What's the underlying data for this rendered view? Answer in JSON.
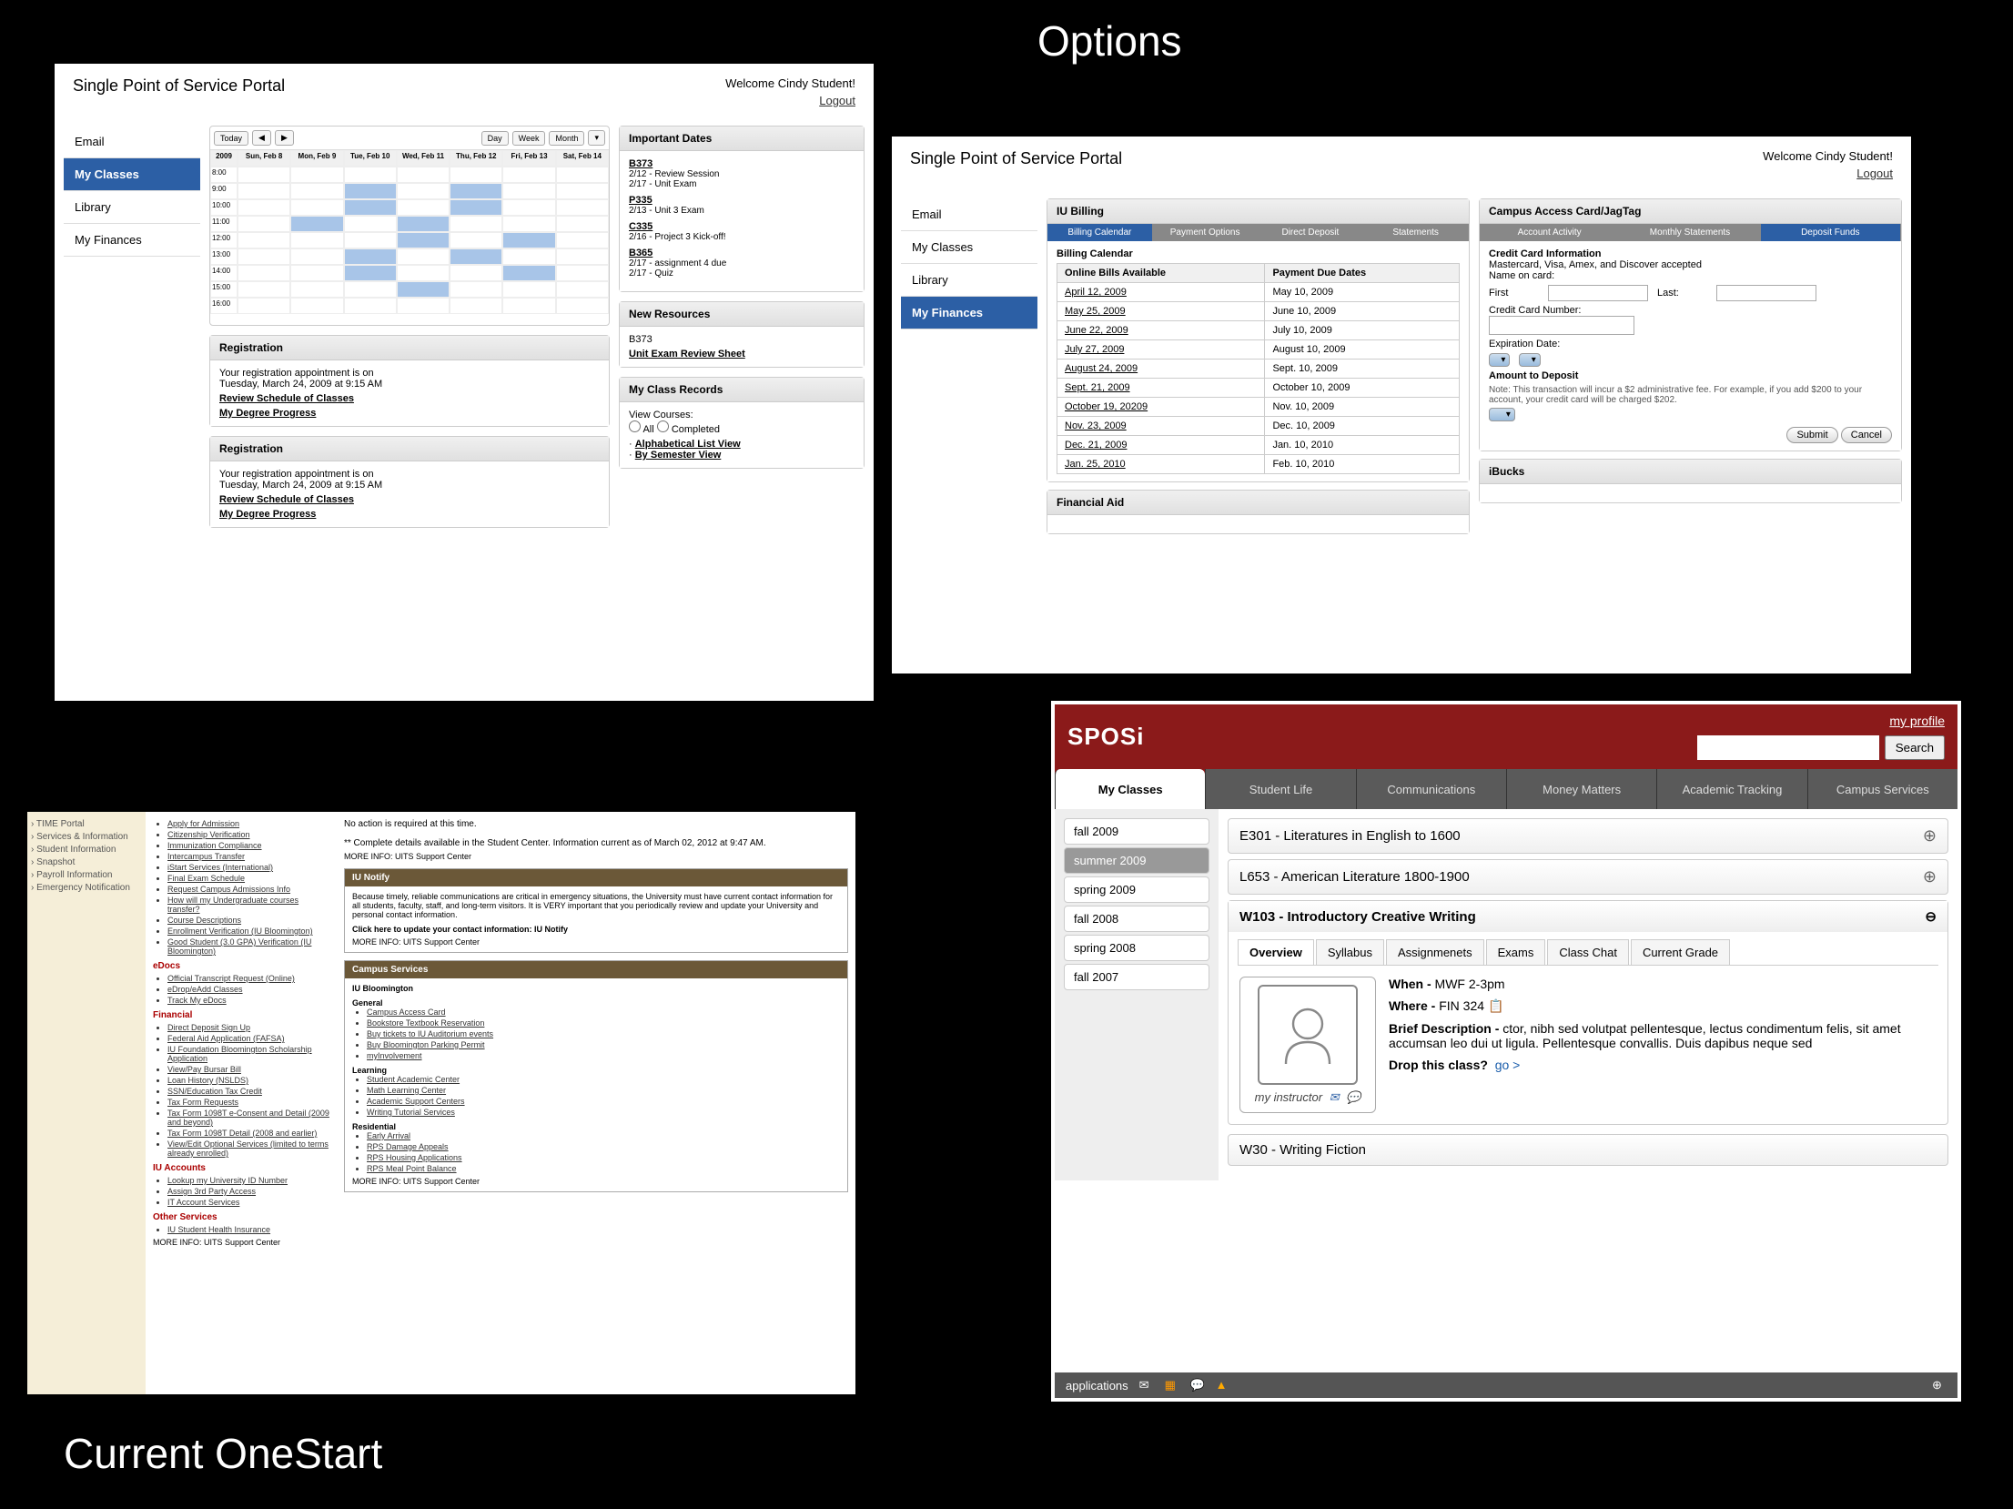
{
  "slideTitles": {
    "options": "Options",
    "current": "Current OneStart"
  },
  "portal": {
    "title": "Single Point of Service Portal",
    "welcome": "Welcome Cindy Student!",
    "logout": "Logout",
    "nav": [
      "Email",
      "My Classes",
      "Library",
      "My Finances"
    ]
  },
  "panel1": {
    "activeNav": "My Classes",
    "calendar": {
      "today": "Today",
      "views": [
        "Day",
        "Week",
        "Month"
      ],
      "days": [
        "Sun, Feb 8",
        "Mon, Feb 9",
        "Tue, Feb 10",
        "Wed, Feb 11",
        "Thu, Feb 12",
        "Fri, Feb 13",
        "Sat, Feb 14"
      ],
      "yearLabel": "2009"
    },
    "importantDates": {
      "title": "Important Dates",
      "items": [
        {
          "course": "B373",
          "lines": [
            "2/12 - Review Session",
            "2/17 - Unit Exam"
          ]
        },
        {
          "course": "P335",
          "lines": [
            "2/13 - Unit 3 Exam"
          ]
        },
        {
          "course": "C335",
          "lines": [
            "2/16 - Project 3 Kick-off!"
          ]
        },
        {
          "course": "B365",
          "lines": [
            "2/17 - assignment 4 due",
            "2/17 - Quiz"
          ]
        }
      ]
    },
    "registration": {
      "title": "Registration",
      "line1": "Your registration appointment is on",
      "line2": "Tuesday, March 24, 2009 at 9:15 AM",
      "links": [
        "Review Schedule of Classes",
        "My Degree Progress"
      ]
    },
    "newResources": {
      "title": "New Resources",
      "course": "B373",
      "link": "Unit Exam Review Sheet"
    },
    "classRecords": {
      "title": "My Class Records",
      "viewLabel": "View Courses:",
      "radio1": "All",
      "radio2": "Completed",
      "links": [
        "Alphabetical List View",
        "By Semester View"
      ]
    }
  },
  "panel2": {
    "activeNav": "My Finances",
    "billing": {
      "title": "IU Billing",
      "tabs": [
        "Billing Calendar",
        "Payment Options",
        "Direct Deposit",
        "Statements"
      ],
      "activeTab": "Billing Calendar",
      "calTitle": "Billing Calendar",
      "col1": "Online Bills Available",
      "col2": "Payment Due Dates",
      "rows": [
        [
          "April 12, 2009",
          "May 10, 2009"
        ],
        [
          "May 25, 2009",
          "June 10, 2009"
        ],
        [
          "June 22, 2009",
          "July 10, 2009"
        ],
        [
          "July 27, 2009",
          "August 10, 2009"
        ],
        [
          "August 24, 2009",
          "Sept. 10, 2009"
        ],
        [
          "Sept. 21, 2009",
          "October 10, 2009"
        ],
        [
          "October 19, 20209",
          "Nov. 10, 2009"
        ],
        [
          "Nov. 23, 2009",
          "Dec. 10, 2009"
        ],
        [
          "Dec. 21, 2009",
          "Jan. 10, 2010"
        ],
        [
          "Jan. 25, 2010",
          "Feb. 10, 2010"
        ]
      ]
    },
    "card": {
      "title": "Campus Access Card/JagTag",
      "tabs": [
        "Account Activity",
        "Monthly Statements",
        "Deposit Funds"
      ],
      "activeTab": "Deposit Funds",
      "ccTitle": "Credit Card Information",
      "ccAccepted": "Mastercard, Visa, Amex, and Discover accepted",
      "nameLabel": "Name on card:",
      "first": "First",
      "last": "Last:",
      "ccNum": "Credit Card Number:",
      "expDate": "Expiration Date:",
      "amount": "Amount to Deposit",
      "note": "Note: This transaction will incur a $2 administrative fee.  For example, if you add $200 to your account, your credit card will be charged $202.",
      "submit": "Submit",
      "cancel": "Cancel"
    },
    "finAid": {
      "title": "Financial Aid"
    },
    "ibucks": {
      "title": "iBucks"
    }
  },
  "panel3": {
    "leftNav": [
      "TIME Portal",
      "Services & Information",
      "Student Information",
      "Snapshot",
      "Payroll Information",
      "Emergency Notification"
    ],
    "mid": {
      "sections": [
        {
          "links": [
            "Apply for Admission",
            "Citizenship Verification",
            "Immunization Compliance",
            "Intercampus Transfer",
            "iStart Services (International)",
            "Final Exam Schedule",
            "Request Campus Admissions Info",
            "How will my Undergraduate courses transfer?",
            "Course Descriptions",
            "Enrollment Verification (IU Bloomington)",
            "Good Student (3.0 GPA) Verification (IU Bloomington)"
          ]
        },
        {
          "head": "eDocs",
          "links": [
            "Official Transcript Request (Online)",
            "eDrop/eAdd Classes",
            "Track My eDocs"
          ]
        },
        {
          "head": "Financial",
          "links": [
            "Direct Deposit Sign Up",
            "Federal Aid Application (FAFSA)",
            "IU Foundation Bloomington Scholarship Application",
            "View/Pay Bursar Bill",
            "Loan History (NSLDS)",
            "SSN/Education Tax Credit",
            "Tax Form Requests",
            "Tax Form 1098T e-Consent and Detail (2009 and beyond)",
            "Tax Form 1098T Detail (2008 and earlier)",
            "View/Edit Optional Services (limited to terms already enrolled)"
          ]
        },
        {
          "head": "IU Accounts",
          "links": [
            "Lookup my University ID Number",
            "Assign 3rd Party Access",
            "IT Account Services"
          ]
        },
        {
          "head": "Other Services",
          "links": [
            "IU Student Health Insurance"
          ]
        }
      ],
      "moreInfo": "MORE INFO: UITS Support Center"
    },
    "right": {
      "topLine": "No action is required at this time.",
      "detailsLine": "** Complete details available in the Student Center. Information current as of March 02, 2012 at 9:47 AM.",
      "moreInfo": "MORE INFO: UITS Support Center",
      "notify": {
        "title": "IU Notify",
        "body": "Because timely, reliable communications are critical in emergency situations, the University must have current contact information for all students, faculty, staff, and long-term visitors. It is VERY important that you periodically review and update your University and personal contact information.",
        "linkLine": "Click here to update your contact information: IU Notify"
      },
      "campus": {
        "title": "Campus Services",
        "sub": "IU Bloomington",
        "cats": [
          {
            "head": "General",
            "links": [
              "Campus Access Card",
              "Bookstore Textbook Reservation",
              "Buy tickets to IU Auditorium events",
              "Buy Bloomington Parking Permit",
              "myInvolvement"
            ]
          },
          {
            "head": "Learning",
            "links": [
              "Student Academic Center",
              "Math Learning Center",
              "Academic Support Centers",
              "Writing Tutorial Services"
            ]
          },
          {
            "head": "Residential",
            "links": [
              "Early Arrival",
              "RPS Damage Appeals",
              "RPS Housing Applications",
              "RPS Meal Point Balance"
            ]
          }
        ]
      }
    }
  },
  "panel4": {
    "brand": "SPOSi",
    "profile": "my profile",
    "search": "Search",
    "tabs": [
      "My Classes",
      "Student Life",
      "Communications",
      "Money Matters",
      "Academic Tracking",
      "Campus Services"
    ],
    "activeTab": "My Classes",
    "terms": [
      "fall 2009",
      "summer 2009",
      "spring 2009",
      "fall 2008",
      "spring 2008",
      "fall 2007"
    ],
    "activeTerm": "summer 2009",
    "courses": [
      {
        "title": "E301 - Literatures in English to 1600",
        "expanded": false
      },
      {
        "title": "L653 - American Literature 1800-1900",
        "expanded": false
      }
    ],
    "expandedCourse": {
      "title": "W103 - Introductory Creative Writing",
      "tabs": [
        "Overview",
        "Syllabus",
        "Assignmenets",
        "Exams",
        "Class Chat",
        "Current Grade"
      ],
      "activeTab": "Overview",
      "instructor": "my instructor",
      "when": "MWF 2-3pm",
      "whenLabel": "When -",
      "where": "FIN 324",
      "whereLabel": "Where -",
      "descLabel": "Brief Description -",
      "desc": "ctor, nibh sed volutpat pellentesque, lectus condimentum felis, sit amet accumsan leo dui ut ligula. Pellentesque convallis. Duis dapibus neque sed",
      "dropLabel": "Drop this class?",
      "dropLink": "go >"
    },
    "lastCourse": "W30 - Writing Fiction",
    "footer": "applications"
  }
}
